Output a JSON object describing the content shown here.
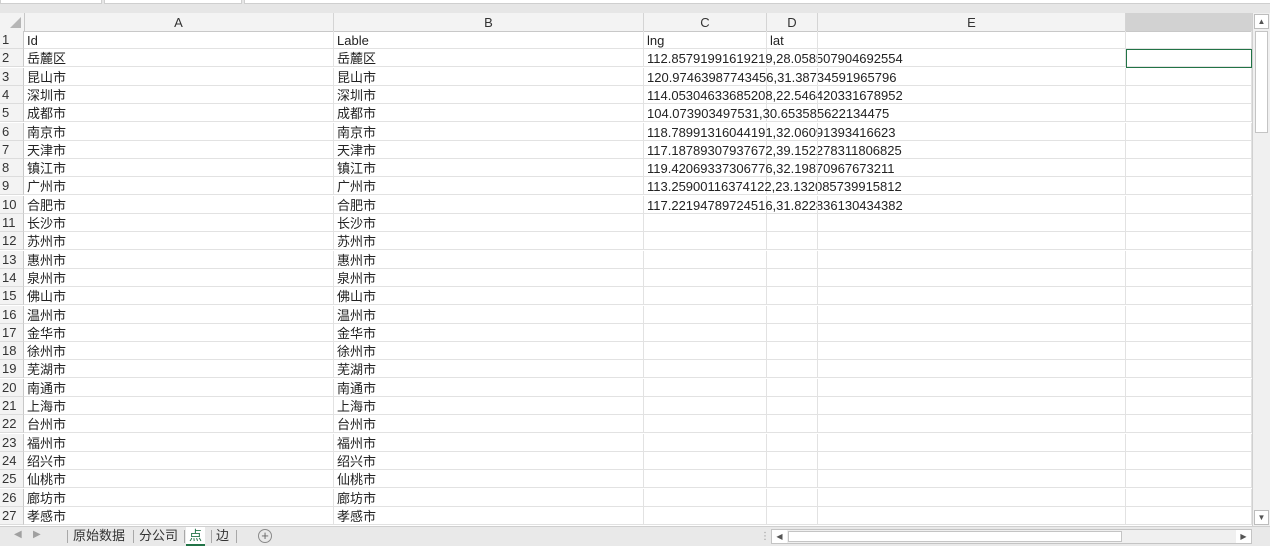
{
  "spreadsheet": {
    "column_headers": [
      "A",
      "B",
      "C",
      "D",
      "E",
      ""
    ],
    "row_numbers": [
      "1",
      "2",
      "3",
      "4",
      "5",
      "6",
      "7",
      "8",
      "9",
      "10",
      "11",
      "12",
      "13",
      "14",
      "15",
      "16",
      "17",
      "18",
      "19",
      "20",
      "21",
      "22",
      "23",
      "24",
      "25",
      "26",
      "27"
    ],
    "rows": [
      {
        "a": "Id",
        "b": "Lable",
        "c": "lng",
        "d": "lat"
      },
      {
        "a": "岳麓区",
        "b": "岳麓区",
        "c": "112.85791991619219,28.058507904692554",
        "d": ""
      },
      {
        "a": "昆山市",
        "b": "昆山市",
        "c": "120.97463987743456,31.38734591965796",
        "d": ""
      },
      {
        "a": "深圳市",
        "b": "深圳市",
        "c": "114.05304633685208,22.546420331678952",
        "d": ""
      },
      {
        "a": "成都市",
        "b": "成都市",
        "c": "104.073903497531,30.653585622134475",
        "d": ""
      },
      {
        "a": "南京市",
        "b": "南京市",
        "c": "118.78991316044191,32.06091393416623",
        "d": ""
      },
      {
        "a": "天津市",
        "b": "天津市",
        "c": "117.18789307937672,39.152278311806825",
        "d": ""
      },
      {
        "a": "镇江市",
        "b": "镇江市",
        "c": "119.42069337306776,32.19870967673211",
        "d": ""
      },
      {
        "a": "广州市",
        "b": "广州市",
        "c": "113.25900116374122,23.132085739915812",
        "d": ""
      },
      {
        "a": "合肥市",
        "b": "合肥市",
        "c": "117.22194789724516,31.822836130434382",
        "d": ""
      },
      {
        "a": "长沙市",
        "b": "长沙市",
        "c": "",
        "d": ""
      },
      {
        "a": "苏州市",
        "b": "苏州市",
        "c": "",
        "d": ""
      },
      {
        "a": "惠州市",
        "b": "惠州市",
        "c": "",
        "d": ""
      },
      {
        "a": "泉州市",
        "b": "泉州市",
        "c": "",
        "d": ""
      },
      {
        "a": "佛山市",
        "b": "佛山市",
        "c": "",
        "d": ""
      },
      {
        "a": "温州市",
        "b": "温州市",
        "c": "",
        "d": ""
      },
      {
        "a": "金华市",
        "b": "金华市",
        "c": "",
        "d": ""
      },
      {
        "a": "徐州市",
        "b": "徐州市",
        "c": "",
        "d": ""
      },
      {
        "a": "芜湖市",
        "b": "芜湖市",
        "c": "",
        "d": ""
      },
      {
        "a": "南通市",
        "b": "南通市",
        "c": "",
        "d": ""
      },
      {
        "a": "上海市",
        "b": "上海市",
        "c": "",
        "d": ""
      },
      {
        "a": "台州市",
        "b": "台州市",
        "c": "",
        "d": ""
      },
      {
        "a": "福州市",
        "b": "福州市",
        "c": "",
        "d": ""
      },
      {
        "a": "绍兴市",
        "b": "绍兴市",
        "c": "",
        "d": ""
      },
      {
        "a": "仙桃市",
        "b": "仙桃市",
        "c": "",
        "d": ""
      },
      {
        "a": "廊坊市",
        "b": "廊坊市",
        "c": "",
        "d": ""
      },
      {
        "a": "孝感市",
        "b": "孝感市",
        "c": "",
        "d": ""
      }
    ]
  },
  "sheet_tabs": [
    {
      "label": "原始数据",
      "active": false
    },
    {
      "label": "分公司",
      "active": false
    },
    {
      "label": "点",
      "active": true
    },
    {
      "label": "边",
      "active": false
    }
  ],
  "icons": {
    "scroll_up": "up-arrow-icon",
    "scroll_down": "down-arrow-icon",
    "scroll_left": "left-arrow-icon",
    "scroll_right": "right-arrow-icon",
    "add_sheet": "plus-circle-icon",
    "prev_sheet": "left-arrow-icon",
    "next_sheet": "right-arrow-icon",
    "select_all": "triangle-corner-icon"
  },
  "colors": {
    "accent": "#217346",
    "header_bg": "#f3f3f3",
    "grid_line": "#e2e2e2"
  }
}
